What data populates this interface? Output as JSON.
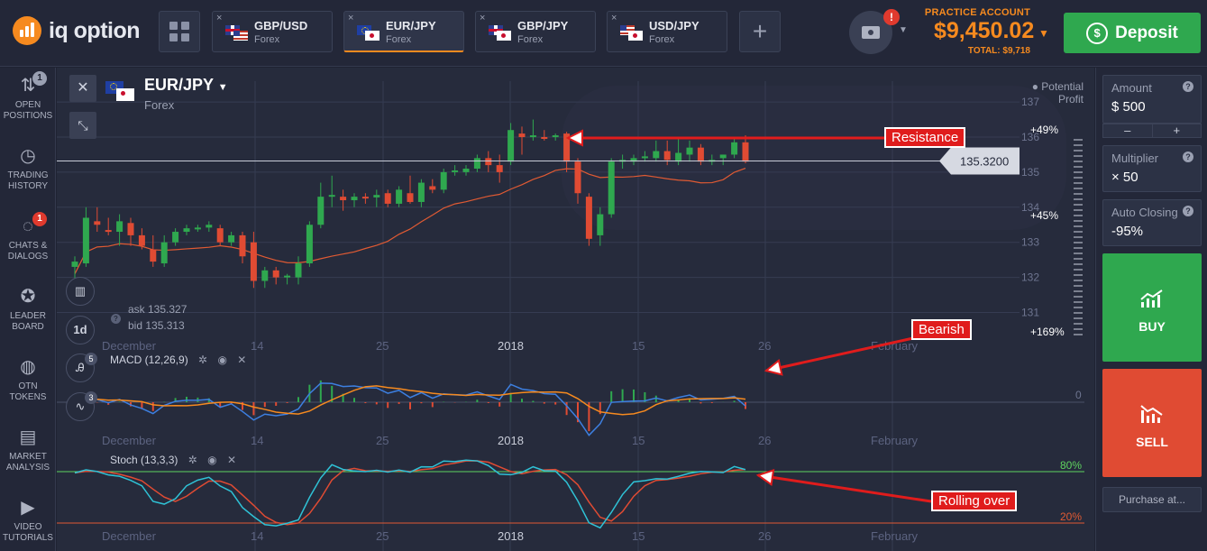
{
  "header": {
    "brand": "iq option",
    "tabs": [
      {
        "pair": "GBP/USD",
        "type": "Forex",
        "flags": [
          "gb",
          "us"
        ],
        "active": false
      },
      {
        "pair": "EUR/JPY",
        "type": "Forex",
        "flags": [
          "eu",
          "jp"
        ],
        "active": true
      },
      {
        "pair": "GBP/JPY",
        "type": "Forex",
        "flags": [
          "gb",
          "jp"
        ],
        "active": false
      },
      {
        "pair": "USD/JPY",
        "type": "Forex",
        "flags": [
          "us",
          "jp"
        ],
        "active": false
      }
    ],
    "tab_close": "×",
    "add_tab": "+",
    "camera_alert": "!",
    "account_label": "PRACTICE ACCOUNT",
    "balance": "$9,450.02",
    "total": "TOTAL: $9,718",
    "deposit_label": "Deposit"
  },
  "sidebar": {
    "items": [
      {
        "label": "OPEN POSITIONS",
        "icon": "sort-arrows-icon",
        "badge": "1",
        "badge_color": "#9aa0b2"
      },
      {
        "label": "TRADING HISTORY",
        "icon": "history-icon",
        "badge": "",
        "badge_color": ""
      },
      {
        "label": "CHATS & DIALOGS",
        "icon": "chat-icon",
        "badge": "1",
        "badge_color": "#e03a2e"
      },
      {
        "label": "LEADER BOARD",
        "icon": "medal-icon",
        "badge": "",
        "badge_color": ""
      },
      {
        "label": "OTN TOKENS",
        "icon": "token-icon",
        "badge": "",
        "badge_color": ""
      },
      {
        "label": "MARKET ANALYSIS",
        "icon": "newspaper-icon",
        "badge": "",
        "badge_color": ""
      },
      {
        "label": "VIDEO TUTORIALS",
        "icon": "play-icon",
        "badge": "",
        "badge_color": ""
      }
    ]
  },
  "asset": {
    "name": "EUR/JPY",
    "type": "Forex",
    "current_price": "135.3200",
    "ask": "ask 135.327",
    "bid": "bid 135.313",
    "timeframe": "1d",
    "potential_profit": "Potential Profit"
  },
  "tools": {
    "indicators_badge": "5",
    "drawings_badge": "3"
  },
  "right_panel": {
    "amount_label": "Amount",
    "amount_value": "$  500",
    "multiplier_label": "Multiplier",
    "multiplier_value": "× 50",
    "auto_closing_label": "Auto Closing",
    "auto_closing_value": "-95%",
    "minus": "–",
    "plus": "+",
    "buy_label": "BUY",
    "sell_label": "SELL",
    "purchase_label": "Purchase at...",
    "help_icon": "?"
  },
  "colors": {
    "accent": "#f68a1f",
    "up": "#2fa84f",
    "down": "#e04b33",
    "annotation": "#e01c1c",
    "macd": "#3d7fe0",
    "signal": "#f68a1f",
    "stoch_k": "#2fc2d6",
    "stoch_d": "#e04b33"
  },
  "chart_data": {
    "type": "candlestick",
    "y_axis_ticks": [
      "137",
      "136",
      "135",
      "134",
      "133",
      "132",
      "131"
    ],
    "x_axis_ticks": [
      "December",
      "14",
      "25",
      "2018",
      "15",
      "26",
      "February"
    ],
    "profit_markers": [
      "+49%",
      "+45%",
      "+169%"
    ],
    "indicators": [
      {
        "name": "MACD (12,26,9)",
        "zero_label": "0"
      },
      {
        "name": "Stoch (13,3,3)",
        "levels": [
          "80%",
          "20%"
        ]
      }
    ],
    "annotations": [
      "Resistance",
      "Bearish",
      "Rolling over"
    ],
    "candles": [
      {
        "o": 132.3,
        "h": 132.6,
        "l": 131.9,
        "c": 132.45
      },
      {
        "o": 132.4,
        "h": 134.0,
        "l": 132.3,
        "c": 133.7
      },
      {
        "o": 133.6,
        "h": 134.0,
        "l": 133.3,
        "c": 133.5
      },
      {
        "o": 133.35,
        "h": 133.7,
        "l": 133.2,
        "c": 133.3
      },
      {
        "o": 133.3,
        "h": 133.8,
        "l": 132.9,
        "c": 133.6
      },
      {
        "o": 133.55,
        "h": 133.7,
        "l": 132.9,
        "c": 133.2
      },
      {
        "o": 133.2,
        "h": 133.4,
        "l": 132.8,
        "c": 132.9
      },
      {
        "o": 132.8,
        "h": 133.2,
        "l": 132.3,
        "c": 132.45
      },
      {
        "o": 132.4,
        "h": 133.2,
        "l": 132.3,
        "c": 133.0
      },
      {
        "o": 133.0,
        "h": 133.4,
        "l": 132.9,
        "c": 133.3
      },
      {
        "o": 133.3,
        "h": 133.5,
        "l": 133.2,
        "c": 133.4
      },
      {
        "o": 133.4,
        "h": 133.5,
        "l": 133.3,
        "c": 133.42
      },
      {
        "o": 133.42,
        "h": 133.6,
        "l": 133.3,
        "c": 133.5
      },
      {
        "o": 133.4,
        "h": 133.5,
        "l": 132.9,
        "c": 133.0
      },
      {
        "o": 133.0,
        "h": 133.3,
        "l": 132.9,
        "c": 133.2
      },
      {
        "o": 133.2,
        "h": 133.3,
        "l": 132.4,
        "c": 132.6
      },
      {
        "o": 133.0,
        "h": 133.3,
        "l": 131.7,
        "c": 131.9
      },
      {
        "o": 131.9,
        "h": 132.3,
        "l": 131.7,
        "c": 132.2
      },
      {
        "o": 132.2,
        "h": 132.3,
        "l": 131.8,
        "c": 132.0
      },
      {
        "o": 132.0,
        "h": 132.1,
        "l": 131.8,
        "c": 132.05
      },
      {
        "o": 132.0,
        "h": 132.6,
        "l": 131.8,
        "c": 132.4
      },
      {
        "o": 132.4,
        "h": 133.6,
        "l": 132.3,
        "c": 133.5
      },
      {
        "o": 133.5,
        "h": 134.7,
        "l": 133.4,
        "c": 134.3
      },
      {
        "o": 134.3,
        "h": 134.9,
        "l": 134.0,
        "c": 134.35
      },
      {
        "o": 134.3,
        "h": 134.5,
        "l": 133.9,
        "c": 134.2
      },
      {
        "o": 134.2,
        "h": 134.4,
        "l": 134.0,
        "c": 134.3
      },
      {
        "o": 134.3,
        "h": 134.4,
        "l": 134.1,
        "c": 134.28
      },
      {
        "o": 134.28,
        "h": 134.5,
        "l": 134.0,
        "c": 134.35
      },
      {
        "o": 134.4,
        "h": 134.5,
        "l": 134.0,
        "c": 134.1
      },
      {
        "o": 134.1,
        "h": 134.6,
        "l": 134.0,
        "c": 134.5
      },
      {
        "o": 134.4,
        "h": 134.9,
        "l": 134.1,
        "c": 134.15
      },
      {
        "o": 134.15,
        "h": 134.8,
        "l": 134.0,
        "c": 134.7
      },
      {
        "o": 134.6,
        "h": 134.8,
        "l": 134.4,
        "c": 134.5
      },
      {
        "o": 134.5,
        "h": 135.1,
        "l": 134.4,
        "c": 135.0
      },
      {
        "o": 135.0,
        "h": 135.2,
        "l": 134.9,
        "c": 135.05
      },
      {
        "o": 135.0,
        "h": 135.2,
        "l": 134.9,
        "c": 135.1
      },
      {
        "o": 135.1,
        "h": 135.5,
        "l": 135.0,
        "c": 135.4
      },
      {
        "o": 135.4,
        "h": 135.6,
        "l": 135.0,
        "c": 135.2
      },
      {
        "o": 135.2,
        "h": 135.5,
        "l": 134.7,
        "c": 135.0
      },
      {
        "o": 135.3,
        "h": 136.4,
        "l": 135.2,
        "c": 136.2
      },
      {
        "o": 136.1,
        "h": 136.3,
        "l": 135.5,
        "c": 136.0
      },
      {
        "o": 136.0,
        "h": 136.5,
        "l": 135.9,
        "c": 136.05
      },
      {
        "o": 136.0,
        "h": 136.2,
        "l": 135.9,
        "c": 135.95
      },
      {
        "o": 136.0,
        "h": 136.1,
        "l": 135.9,
        "c": 136.05
      },
      {
        "o": 136.1,
        "h": 136.15,
        "l": 135.0,
        "c": 135.3
      },
      {
        "o": 135.3,
        "h": 135.4,
        "l": 134.1,
        "c": 134.4
      },
      {
        "o": 134.3,
        "h": 134.4,
        "l": 132.9,
        "c": 133.1
      },
      {
        "o": 133.2,
        "h": 134.0,
        "l": 132.9,
        "c": 133.8
      },
      {
        "o": 133.8,
        "h": 135.4,
        "l": 133.7,
        "c": 135.3
      },
      {
        "o": 135.3,
        "h": 135.5,
        "l": 135.1,
        "c": 135.35
      },
      {
        "o": 135.3,
        "h": 135.5,
        "l": 135.2,
        "c": 135.4
      },
      {
        "o": 135.4,
        "h": 135.6,
        "l": 135.3,
        "c": 135.45
      },
      {
        "o": 135.4,
        "h": 135.9,
        "l": 135.3,
        "c": 135.6
      },
      {
        "o": 135.6,
        "h": 135.9,
        "l": 135.2,
        "c": 135.35
      },
      {
        "o": 135.3,
        "h": 136.0,
        "l": 135.2,
        "c": 135.55
      },
      {
        "o": 135.5,
        "h": 135.9,
        "l": 135.3,
        "c": 135.7
      },
      {
        "o": 135.7,
        "h": 135.8,
        "l": 135.2,
        "c": 135.3
      },
      {
        "o": 135.3,
        "h": 135.5,
        "l": 135.2,
        "c": 135.35
      },
      {
        "o": 135.4,
        "h": 135.5,
        "l": 135.2,
        "c": 135.5
      },
      {
        "o": 135.5,
        "h": 135.95,
        "l": 135.4,
        "c": 135.85
      },
      {
        "o": 135.85,
        "h": 136.05,
        "l": 135.25,
        "c": 135.3
      }
    ]
  }
}
